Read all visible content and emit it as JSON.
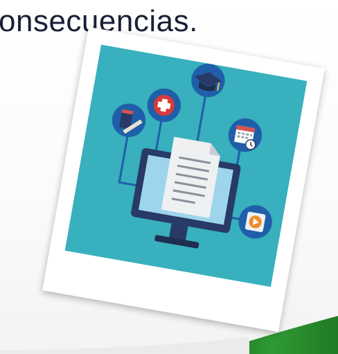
{
  "slide": {
    "text_line": "onsecuencias."
  },
  "illustration": {
    "icons": [
      "book-pencil-icon",
      "medical-cross-icon",
      "graduation-cap-icon",
      "calendar-clock-icon",
      "play-icon",
      "document-icon",
      "computer-monitor-icon"
    ]
  },
  "colors": {
    "photo_background": "#38b0bd",
    "circle_blue": "#1f5fa9",
    "monitor_dark": "#283a66",
    "screen": "#9ed5ec",
    "green_accent": "#2e8b32"
  }
}
